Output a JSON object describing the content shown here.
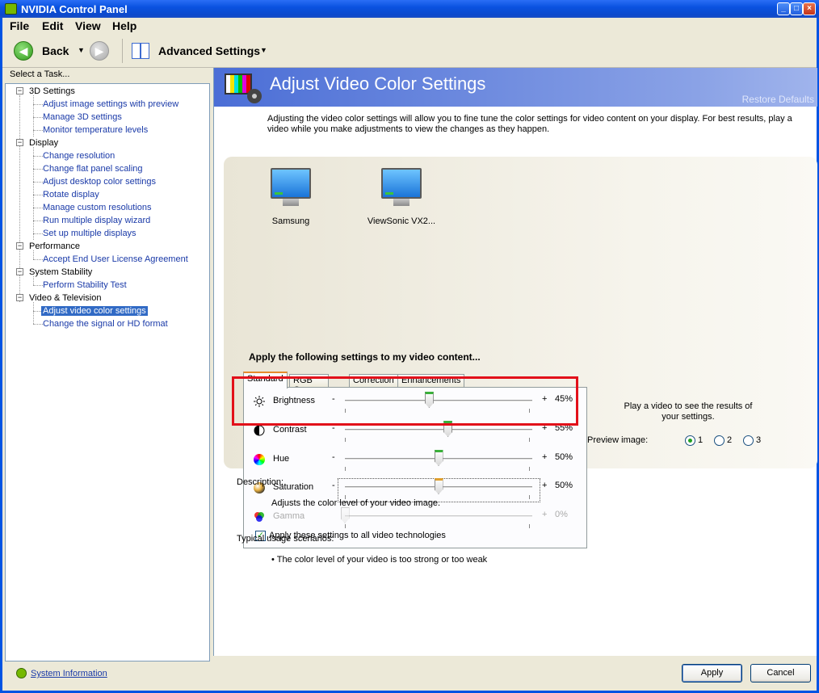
{
  "window": {
    "title": "NVIDIA Control Panel"
  },
  "menu": {
    "file": "File",
    "edit": "Edit",
    "view": "View",
    "help": "Help"
  },
  "toolbar": {
    "back_label": "Back",
    "advanced_label": "Advanced Settings"
  },
  "sidebar": {
    "header": "Select a Task...",
    "categories": [
      {
        "label": "3D Settings",
        "items": [
          "Adjust image settings with preview",
          "Manage 3D settings",
          "Monitor temperature levels"
        ]
      },
      {
        "label": "Display",
        "items": [
          "Change resolution",
          "Change flat panel scaling",
          "Adjust desktop color settings",
          "Rotate display",
          "Manage custom resolutions",
          "Run multiple display wizard",
          "Set up multiple displays"
        ]
      },
      {
        "label": "Performance",
        "items": [
          "Accept End User License Agreement"
        ]
      },
      {
        "label": "System Stability",
        "items": [
          "Perform Stability Test"
        ]
      },
      {
        "label": "Video & Television",
        "items": [
          "Adjust video color settings",
          "Change the signal or HD format"
        ]
      }
    ],
    "selected_item": "Adjust video color settings",
    "system_info": "System Information"
  },
  "page": {
    "title": "Adjust Video Color Settings",
    "restore_defaults": "Restore Defaults",
    "intro": "Adjusting the video color settings will allow you to fine tune the color settings for video content on your display.  For best results, play a video while you make adjustments to view the changes as they happen.",
    "displays": [
      "Samsung",
      "ViewSonic VX2..."
    ],
    "apply_heading": "Apply the following settings to my video content...",
    "tabs": [
      "Standard",
      "RGB Gamma",
      "Correction",
      "Enhancements"
    ],
    "sliders": [
      {
        "label": "Brightness",
        "value": 45,
        "value_text": "45%"
      },
      {
        "label": "Contrast",
        "value": 55,
        "value_text": "55%"
      },
      {
        "label": "Hue",
        "value": 50,
        "value_text": "50%"
      },
      {
        "label": "Saturation",
        "value": 50,
        "value_text": "50%"
      },
      {
        "label": "Gamma",
        "value": 0,
        "value_text": "0%"
      }
    ],
    "minus": "-",
    "plus": "+",
    "apply_all_label": "Apply these settings to all video technologies",
    "apply_all_checked": true,
    "preview_message": "Play a video to see the results of your settings.",
    "preview_image_label": "Preview image:",
    "preview_options": [
      "1",
      "2",
      "3"
    ],
    "preview_selected": "1",
    "description_label": "Description:",
    "description_text": "Adjusts the color level of your video image.",
    "usage_label": "Typical usage scenarios:",
    "usage_items": [
      "The color level of your video is too strong or too weak"
    ]
  },
  "buttons": {
    "apply": "Apply",
    "cancel": "Cancel"
  },
  "colors": {
    "highlight": "#e2101a",
    "banner": "#4b6ed6",
    "link": "#1a3aa8",
    "nvidia_green": "#76b900"
  }
}
